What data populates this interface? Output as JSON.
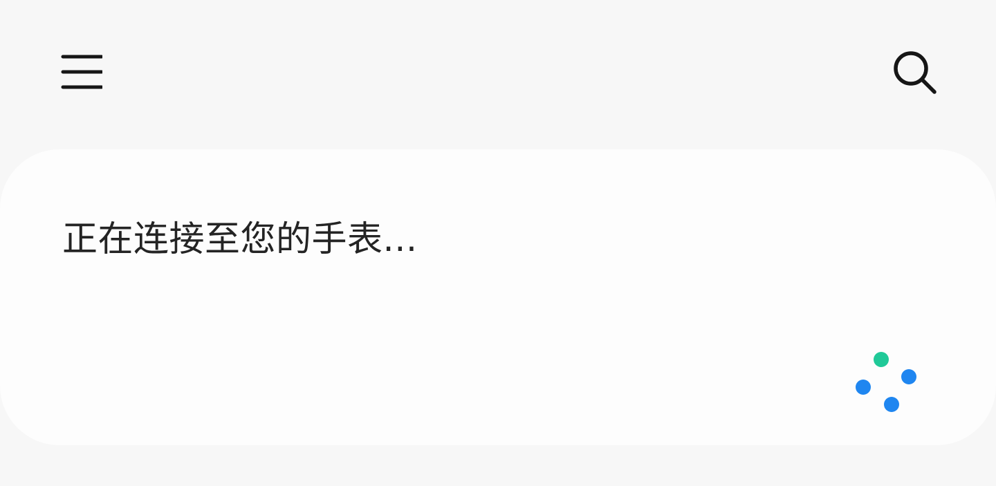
{
  "header": {
    "menu_icon": "menu-icon",
    "search_icon": "search-icon"
  },
  "status": {
    "text": "正在连接至您的手表..."
  },
  "loading_indicator": {
    "top_dot_color": "#20c998",
    "other_dot_color": "#1f86f0"
  },
  "colors": {
    "background": "#f7f7f7",
    "card": "#fdfdfd",
    "text": "#242424"
  }
}
